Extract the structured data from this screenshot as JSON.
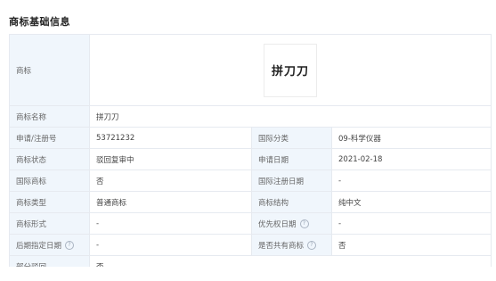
{
  "section": {
    "title": "商标基础信息"
  },
  "trademark": {
    "logo_label": "商标",
    "logo_text": "拼刀刀",
    "rows": [
      {
        "l1": "商标名称",
        "v1": "拼刀刀"
      },
      {
        "l1": "申请/注册号",
        "v1": "53721232",
        "l2": "国际分类",
        "v2": "09-科学仪器"
      },
      {
        "l1": "商标状态",
        "v1": "驳回复审中",
        "l2": "申请日期",
        "v2": "2021-02-18"
      },
      {
        "l1": "国际商标",
        "v1": "否",
        "l2": "国际注册日期",
        "v2": "-"
      },
      {
        "l1": "商标类型",
        "v1": "普通商标",
        "l2": "商标结构",
        "v2": "纯中文"
      },
      {
        "l1": "商标形式",
        "v1": "-",
        "l2": "优先权日期",
        "v2": "-"
      },
      {
        "l1": "后期指定日期",
        "v1": "-",
        "l2": "是否共有商标",
        "v2": "否"
      },
      {
        "l1": "部分驳回",
        "v1": "否"
      }
    ]
  },
  "icons": {
    "help": "question-circle-icon",
    "help_glyph": "?"
  }
}
